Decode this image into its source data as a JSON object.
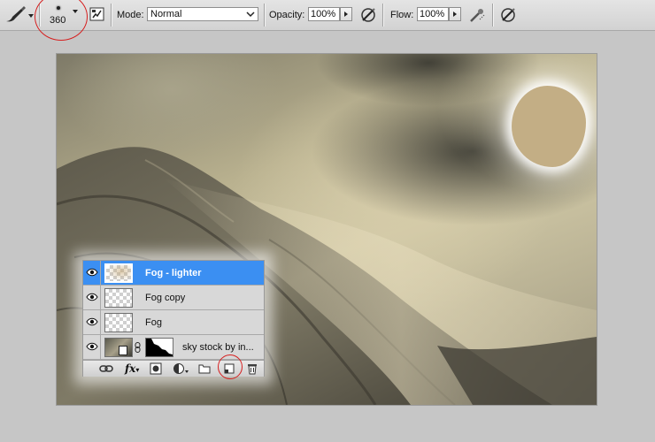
{
  "options_bar": {
    "brush_size": "360",
    "mode_label": "Mode:",
    "mode_value": "Normal",
    "opacity_label": "Opacity:",
    "opacity_value": "100%",
    "flow_label": "Flow:",
    "flow_value": "100%"
  },
  "icons": {
    "tool_preset": "brush-icon",
    "brush_panel": "brush-panel-toggle-icon",
    "pressure_opacity": "tablet-pressure-icon",
    "airbrush": "airbrush-icon",
    "pressure_size": "tablet-pressure-icon"
  },
  "layers_panel": {
    "layers": [
      {
        "name": "Fog - lighter",
        "selected": true,
        "visible": true
      },
      {
        "name": "Fog copy",
        "selected": false,
        "visible": true
      },
      {
        "name": "Fog",
        "selected": false,
        "visible": true
      },
      {
        "name": "sky stock by in...",
        "selected": false,
        "visible": true
      }
    ],
    "footer_icons": [
      "link-layers-icon",
      "fx-icon",
      "add-mask-icon",
      "adjustment-layer-icon",
      "new-group-icon",
      "new-layer-icon",
      "trash-icon"
    ],
    "fx_label": "fx"
  },
  "colors": {
    "selection": "#3b8ff2",
    "highlight_circle": "#d61f1f",
    "sun": "#c3ae85"
  }
}
